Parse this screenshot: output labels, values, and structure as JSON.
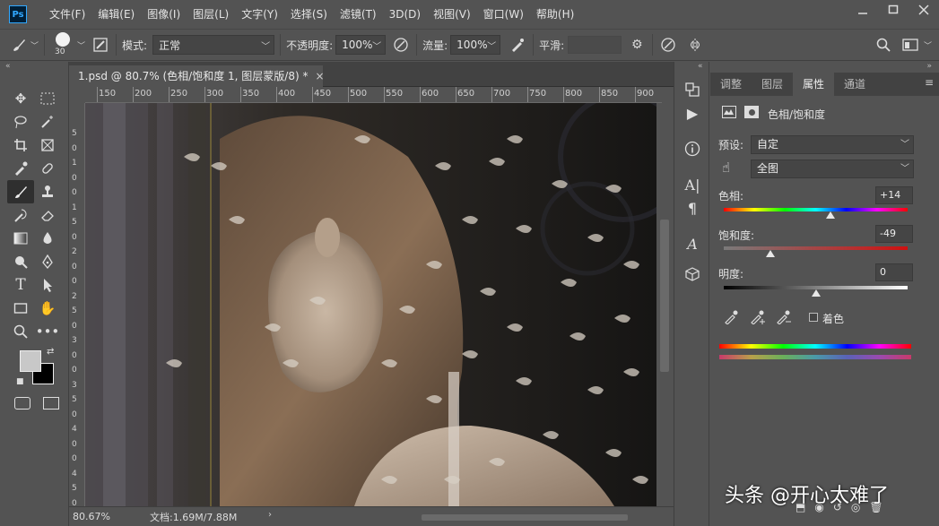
{
  "app": {
    "logo": "Ps",
    "menu": [
      "文件(F)",
      "编辑(E)",
      "图像(I)",
      "图层(L)",
      "文字(Y)",
      "选择(S)",
      "滤镜(T)",
      "3D(D)",
      "视图(V)",
      "窗口(W)",
      "帮助(H)"
    ]
  },
  "options": {
    "brush_size": "30",
    "mode_label": "模式:",
    "mode_value": "正常",
    "opacity_label": "不透明度:",
    "opacity_value": "100%",
    "flow_label": "流量:",
    "flow_value": "100%",
    "smooth_label": "平滑:"
  },
  "document": {
    "tab_title": "1.psd @ 80.7% (色相/饱和度 1, 图层蒙版/8) *",
    "close": "×",
    "ruler_top": [
      "150",
      "200",
      "250",
      "300",
      "350",
      "400",
      "450",
      "500",
      "550",
      "600",
      "650",
      "700",
      "750",
      "800",
      "850",
      "900"
    ],
    "ruler_left": [
      "5",
      "0",
      "1",
      "0",
      "0",
      "1",
      "5",
      "0",
      "2",
      "0",
      "0",
      "2",
      "5",
      "0",
      "3",
      "0",
      "0",
      "3",
      "5",
      "0",
      "4",
      "0",
      "0",
      "4",
      "5",
      "0"
    ],
    "zoom": "80.67%",
    "doc_info": "文档:1.69M/7.88M"
  },
  "panel": {
    "tabs": [
      "调整",
      "图层",
      "属性",
      "通道"
    ],
    "active_tab": "属性",
    "header": "色相/饱和度",
    "preset_label": "预设:",
    "preset_value": "自定",
    "channel_value": "全图",
    "hue_label": "色相:",
    "hue_value": "+14",
    "hue_pos": 0.58,
    "saturation_label": "饱和度:",
    "saturation_value": "-49",
    "saturation_pos": 0.255,
    "lightness_label": "明度:",
    "lightness_value": "0",
    "lightness_pos": 0.5,
    "colorize_label": "着色"
  },
  "watermark": "头条 @开心太难了"
}
